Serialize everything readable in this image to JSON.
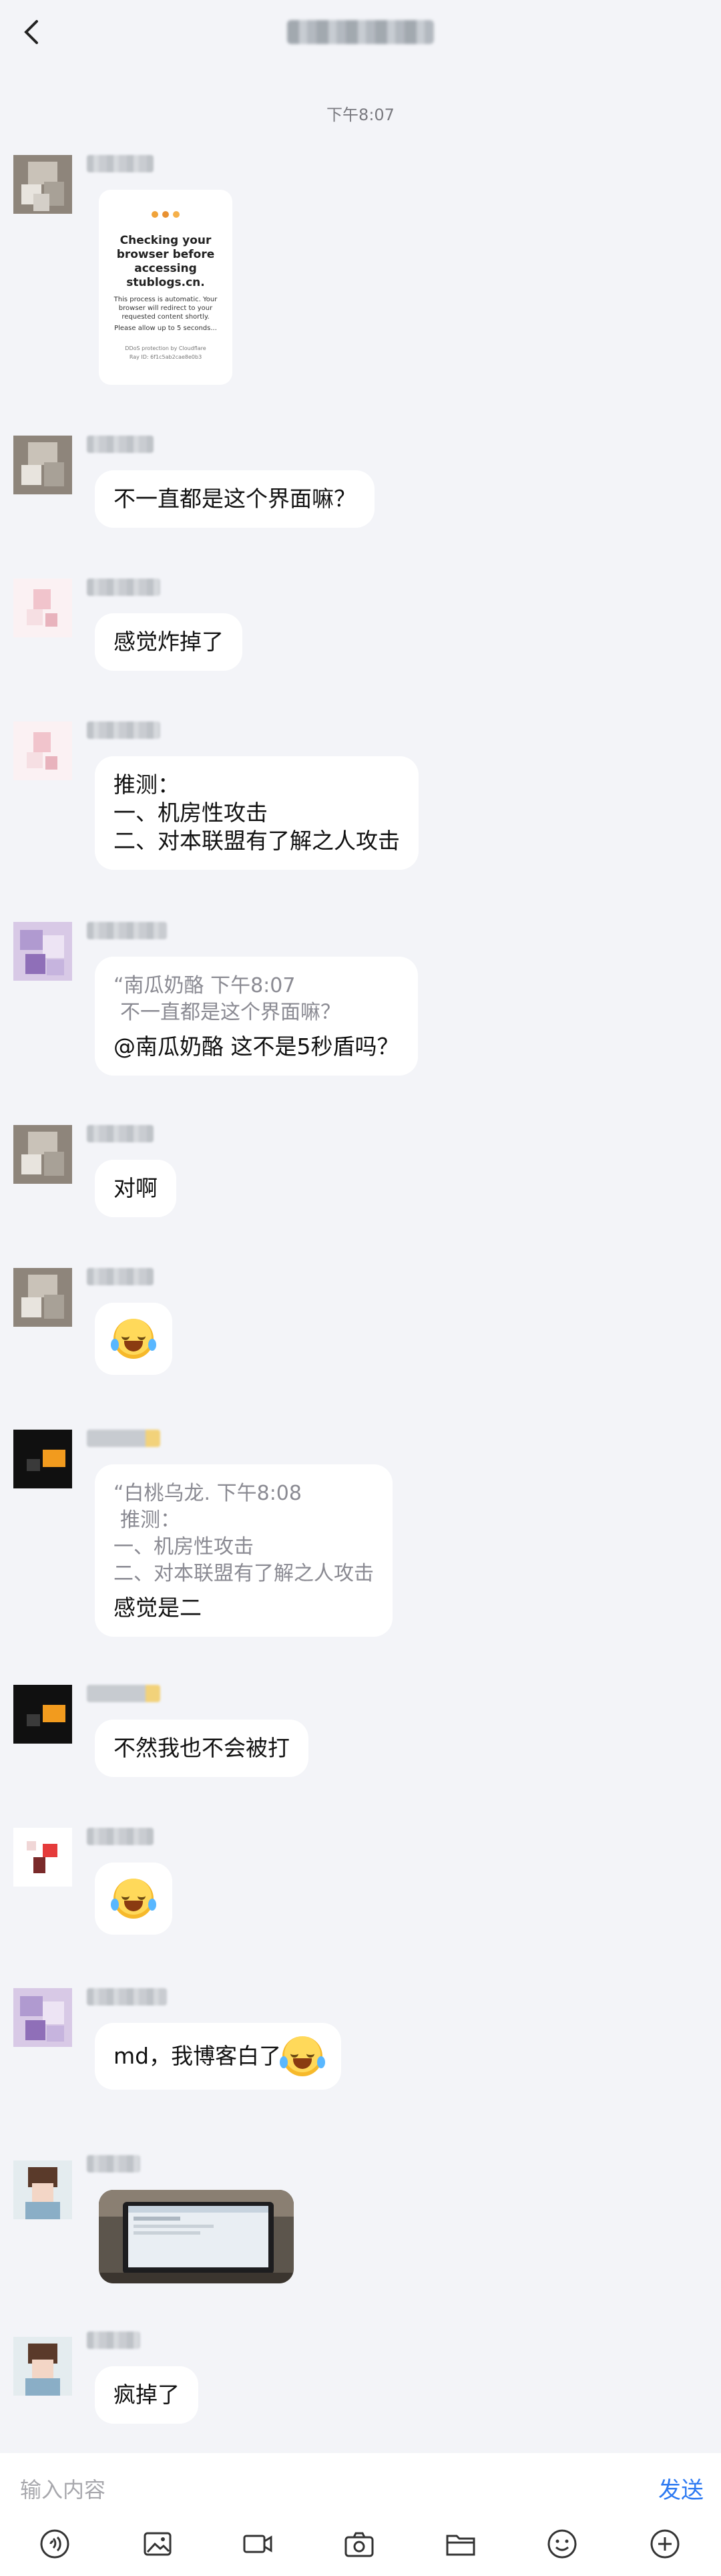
{
  "header": {
    "back_icon": "chevron-left-icon"
  },
  "timestamp": "下午8:07",
  "messages": [
    {
      "type": "image_card",
      "card": {
        "title": "Checking your browser before accessing stublogs.cn.",
        "body": "This process is automatic. Your browser will redirect to your requested content shortly.",
        "wait": "Please allow up to 5 seconds...",
        "footer": "DDoS protection by Cloudflare",
        "ray": "Ray ID: 6f1c5ab2cae8e0b3"
      }
    },
    {
      "type": "text",
      "text": "不一直都是这个界面嘛？"
    },
    {
      "type": "text",
      "text": "感觉炸掉了"
    },
    {
      "type": "text",
      "lines": [
        "推测：",
        "一、机房性攻击",
        "二、对本联盟有了解之人攻击"
      ]
    },
    {
      "type": "quote",
      "quote_head": "“南瓜奶酪 下午8:07",
      "quote_body": "不一直都是这个界面嘛？",
      "text": "@南瓜奶酪 这不是5秒盾吗？"
    },
    {
      "type": "text",
      "text": "对啊"
    },
    {
      "type": "emoji",
      "emoji": "laughing-tears-emoji"
    },
    {
      "type": "quote",
      "quote_head": "“白桃乌龙. 下午8:08",
      "quote_lines": [
        "推测：",
        "一、机房性攻击",
        "二、对本联盟有了解之人攻击"
      ],
      "text": "感觉是二"
    },
    {
      "type": "text",
      "text": "不然我也不会被打"
    },
    {
      "type": "emoji",
      "emoji": "laughing-tears-emoji"
    },
    {
      "type": "text",
      "text": "md，我博客白了"
    },
    {
      "type": "image",
      "image": "laptop-photo"
    },
    {
      "type": "text",
      "text": "疯掉了"
    }
  ],
  "input": {
    "placeholder": "输入内容",
    "send_label": "发送"
  },
  "toolbar": [
    "voice-icon",
    "image-icon",
    "video-icon",
    "camera-icon",
    "folder-icon",
    "emoji-icon",
    "plus-icon"
  ],
  "colors": {
    "background": "#f3f4f8",
    "bubble": "#ffffff",
    "accent": "#2f7bf2"
  }
}
